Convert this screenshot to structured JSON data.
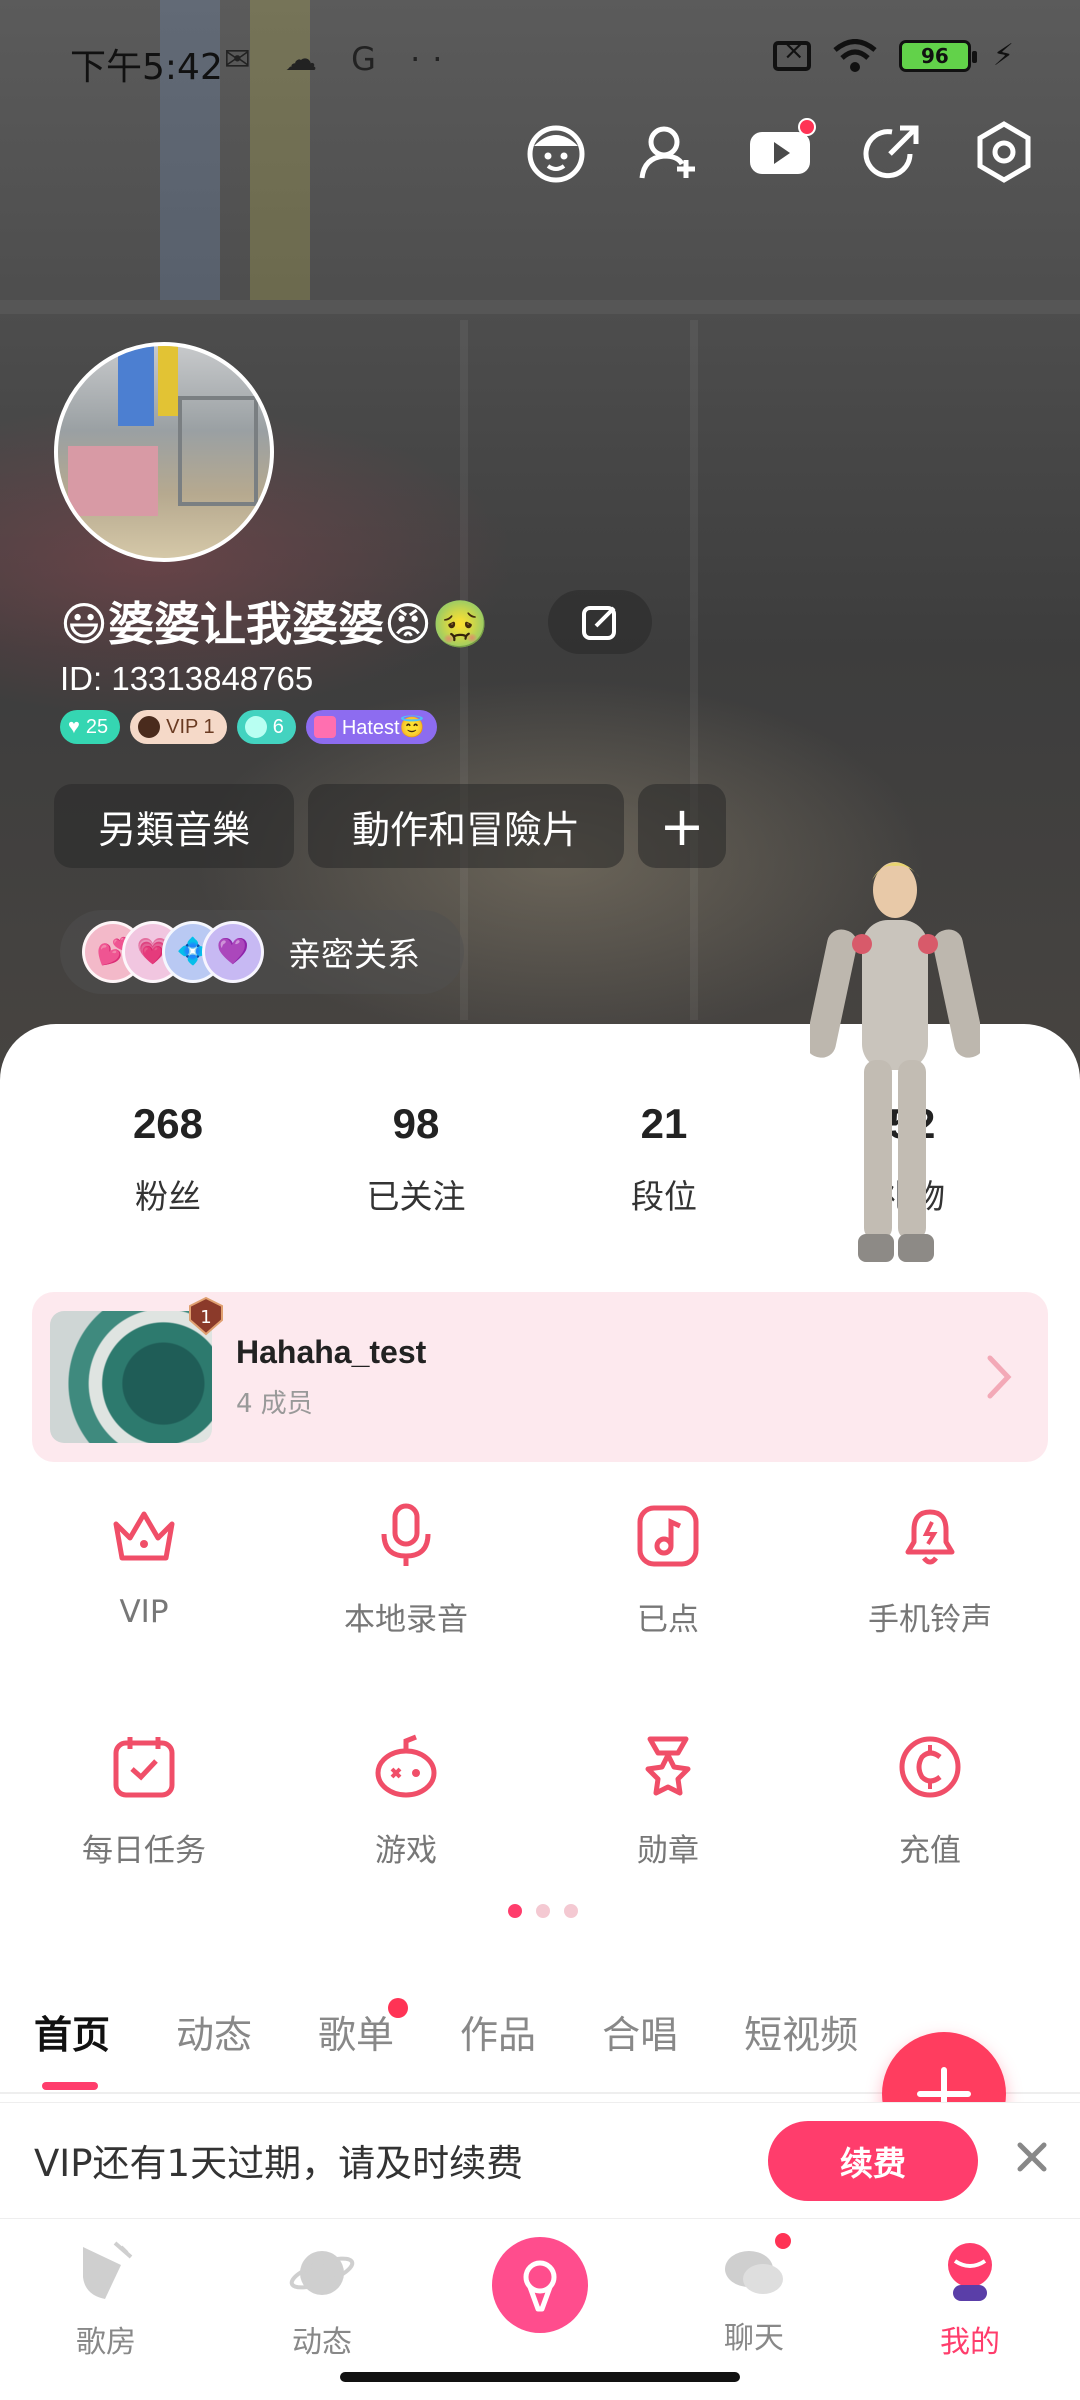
{
  "status_bar": {
    "time": "下午5:42",
    "left_icons": "✉ ☁ G ··",
    "battery": "96"
  },
  "profile": {
    "nickname": "😃婆婆让我婆婆😡🤢",
    "user_id": "ID: 13313848765",
    "badges": {
      "level": "25",
      "vip": "VIP 1",
      "gem": "6",
      "group": "Hatest😇"
    },
    "tags": [
      "另類音樂",
      "動作和冒險片"
    ],
    "add_tag": "+",
    "intimacy_label": "亲密关系"
  },
  "stats": [
    {
      "value": "268",
      "label": "粉丝"
    },
    {
      "value": "98",
      "label": "已关注"
    },
    {
      "value": "21",
      "label": "段位"
    },
    {
      "value": "52",
      "label": "礼物"
    }
  ],
  "club": {
    "name": "Hahaha_test",
    "members": "4 成员",
    "badge_number": "1"
  },
  "grid": [
    [
      {
        "label": "VIP",
        "icon": "crown-icon"
      },
      {
        "label": "本地录音",
        "icon": "microphone-icon"
      },
      {
        "label": "已点",
        "icon": "music-note-icon"
      },
      {
        "label": "手机铃声",
        "icon": "bell-icon"
      }
    ],
    [
      {
        "label": "每日任务",
        "icon": "calendar-check-icon"
      },
      {
        "label": "游戏",
        "icon": "game-icon"
      },
      {
        "label": "勋章",
        "icon": "medal-icon"
      },
      {
        "label": "充值",
        "icon": "coin-icon"
      }
    ]
  ],
  "tabs": [
    "首页",
    "动态",
    "歌单",
    "作品",
    "合唱",
    "短视频"
  ],
  "vip_notice": {
    "text": "VIP还有1天过期，请及时续费",
    "button": "续费"
  },
  "bottom_nav": [
    "歌房",
    "动态",
    "聊天",
    "我的"
  ],
  "colors": {
    "accent": "#ff3d6c",
    "icon": "#f04e68",
    "club_bg": "#fde9ee"
  }
}
